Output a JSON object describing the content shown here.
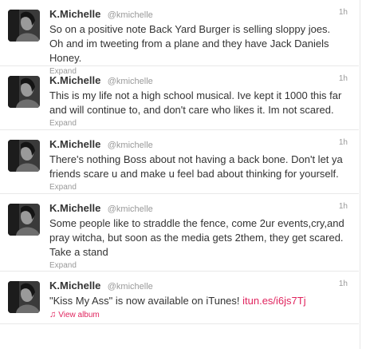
{
  "tweets": [
    {
      "fullname": "K.Michelle",
      "username": "@kmichelle",
      "time": "1h",
      "text": "So on a positive note Back Yard Burger is selling sloppy joes. Oh and im tweeting from a plane and they have Jack Daniels Honey.",
      "action": "Expand"
    },
    {
      "fullname": "K.Michelle",
      "username": "@kmichelle",
      "time": "1h",
      "text": "This is my life not a high school musical. Ive kept it 1000 this far and will continue to, and don't care who likes it. Im not scared.",
      "action": "Expand"
    },
    {
      "fullname": "K.Michelle",
      "username": "@kmichelle",
      "time": "1h",
      "text": "There's nothing Boss about not having a back bone. Don't let ya friends scare u and make u feel bad about thinking for yourself.",
      "action": "Expand"
    },
    {
      "fullname": "K.Michelle",
      "username": "@kmichelle",
      "time": "1h",
      "text": "Some people like to straddle the fence, come 2ur events,cry,and pray witcha, but soon as the media gets 2them, they get scared. Take a stand",
      "action": "Expand"
    },
    {
      "fullname": "K.Michelle",
      "username": "@kmichelle",
      "time": "1h",
      "text": "\"Kiss My Ass\" is now available on iTunes! ",
      "link": "itun.es/i6js7Tj",
      "action": "View album",
      "action_icon": "music-note-icon"
    }
  ],
  "colors": {
    "link": "#e0245e",
    "muted": "#999999",
    "text": "#333333"
  }
}
